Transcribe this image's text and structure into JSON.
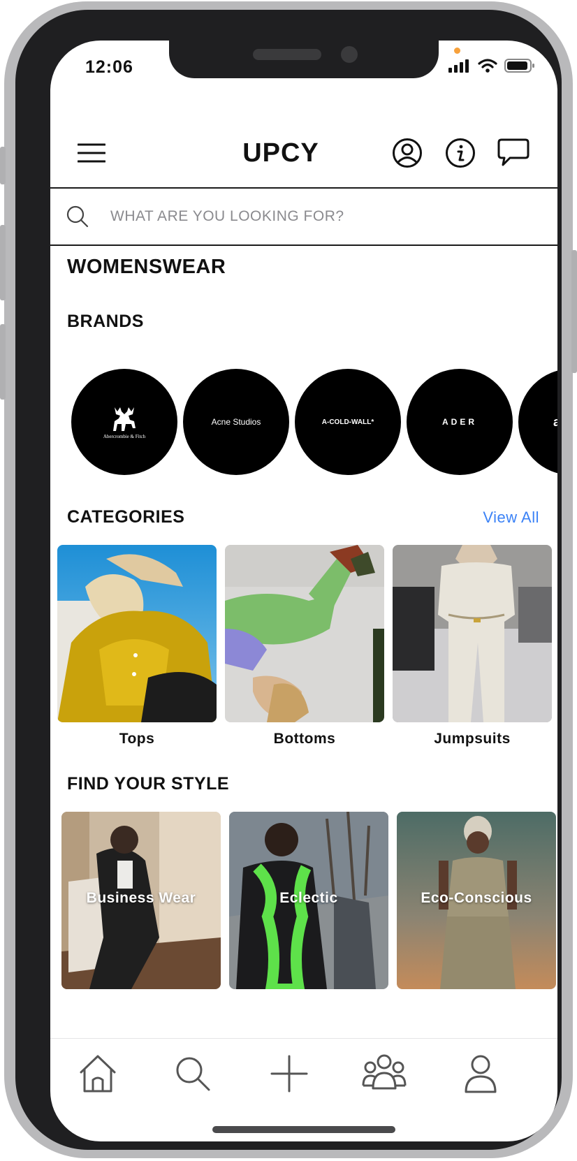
{
  "status_bar": {
    "time": "12:06"
  },
  "header": {
    "title": "UPCY"
  },
  "search": {
    "placeholder": "WHAT ARE YOU LOOKING FOR?"
  },
  "main": {
    "section_title": "WOMENSWEAR",
    "brands": {
      "title": "BRANDS",
      "items": [
        {
          "label": "Abercrombie & Fitch"
        },
        {
          "label": "Acne Studios"
        },
        {
          "label": "A-COLD-WALL*"
        },
        {
          "label": "ADER"
        },
        {
          "label": "a"
        }
      ]
    },
    "categories": {
      "title": "CATEGORIES",
      "view_all": "View All",
      "items": [
        {
          "label": "Tops"
        },
        {
          "label": "Bottoms"
        },
        {
          "label": "Jumpsuits"
        }
      ]
    },
    "find_your_style": {
      "title": "FIND YOUR STYLE",
      "items": [
        {
          "label": "Business Wear"
        },
        {
          "label": "Eclectic"
        },
        {
          "label": "Eco-Conscious"
        }
      ]
    }
  },
  "tab_bar": {
    "items": [
      {
        "icon": "home-icon"
      },
      {
        "icon": "search-icon"
      },
      {
        "icon": "plus-icon"
      },
      {
        "icon": "community-icon"
      },
      {
        "icon": "profile-icon"
      }
    ]
  },
  "colors": {
    "accent_link": "#3b82f6",
    "brand_circle": "#000000"
  }
}
